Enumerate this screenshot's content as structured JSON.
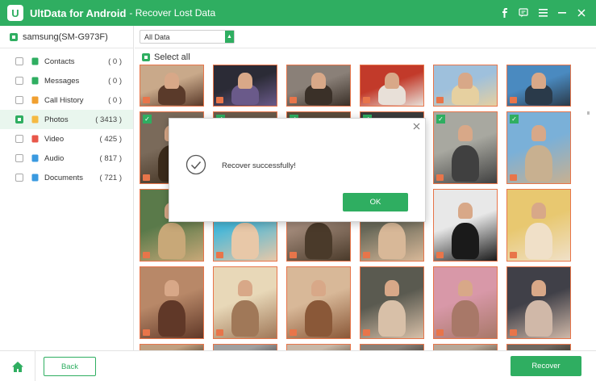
{
  "titlebar": {
    "logo": "U",
    "app_name": "UltData for Android",
    "subtitle": "- Recover Lost Data",
    "icons": [
      "facebook-icon",
      "feedback-icon",
      "menu-icon",
      "minimize-icon",
      "close-icon"
    ]
  },
  "sidebar": {
    "device_name": "samsung(SM-G973F)",
    "categories": [
      {
        "label": "Contacts",
        "count": "( 0 )",
        "icon": "contacts-icon",
        "color": "#2fae61",
        "active": false
      },
      {
        "label": "Messages",
        "count": "( 0 )",
        "icon": "messages-icon",
        "color": "#2fae61",
        "active": false
      },
      {
        "label": "Call History",
        "count": "( 0 )",
        "icon": "call-history-icon",
        "color": "#f0a030",
        "active": false
      },
      {
        "label": "Photos",
        "count": "( 3413 )",
        "icon": "photos-icon",
        "color": "#f5b942",
        "active": true
      },
      {
        "label": "Video",
        "count": "( 425 )",
        "icon": "video-icon",
        "color": "#e8574a",
        "active": false
      },
      {
        "label": "Audio",
        "count": "( 817 )",
        "icon": "audio-icon",
        "color": "#3a9ae0",
        "active": false
      },
      {
        "label": "Documents",
        "count": "( 721 )",
        "icon": "documents-icon",
        "color": "#3a9ae0",
        "active": false
      }
    ]
  },
  "filter": {
    "selected": "All Data"
  },
  "select_all_label": "Select all",
  "photos": {
    "selected_count": 6
  },
  "dialog": {
    "message": "Recover successfully!",
    "ok_label": "OK",
    "close_icon": "close-icon"
  },
  "footer": {
    "back_label": "Back",
    "recover_label": "Recover"
  },
  "colors": {
    "accent": "#2fae61",
    "thumb_border": "#e8754a"
  }
}
